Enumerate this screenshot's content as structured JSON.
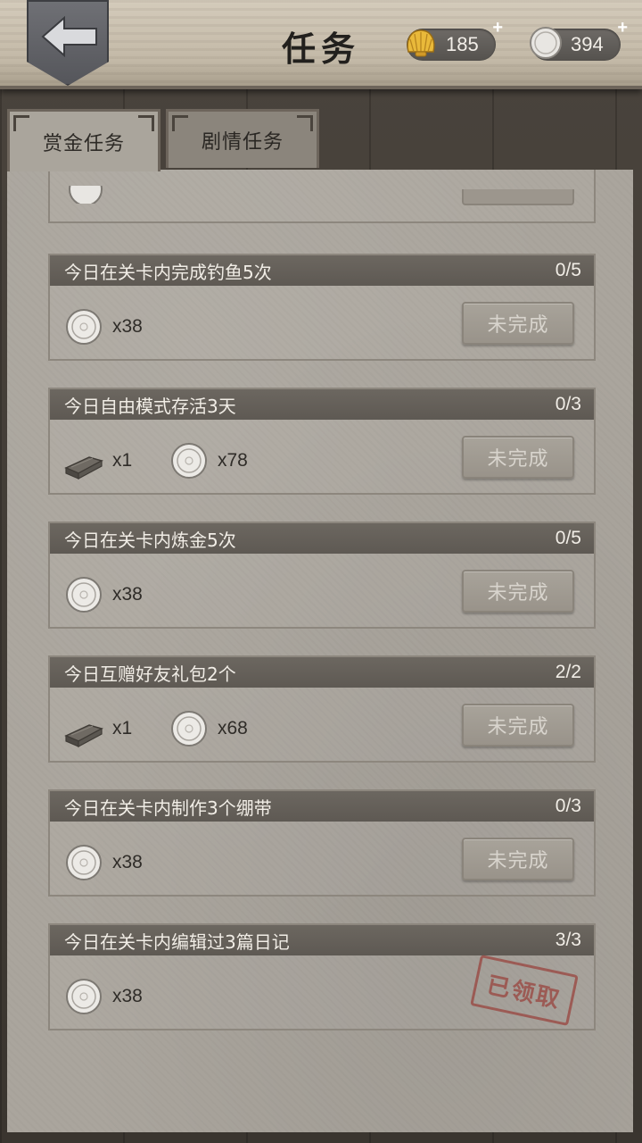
{
  "header": {
    "title": "任务",
    "shells": "185",
    "coins": "394",
    "plus": "+"
  },
  "tabs": [
    {
      "label": "赏金任务",
      "active": true
    },
    {
      "label": "剧情任务",
      "active": false
    }
  ],
  "icons": {
    "back": "arrow-left-icon",
    "shell": "shell-icon",
    "coin": "coin-icon",
    "wood": "wood-plank-icon"
  },
  "colors": {
    "paper": "#aaa59d",
    "task_header": "#6c6760",
    "stamp": "#9a4a44"
  },
  "tasks": [
    {
      "title": "今日在关卡内完成钓鱼5次",
      "progress": "0/5",
      "rewards": [
        {
          "icon": "coin-icon",
          "qty": "x38"
        }
      ],
      "button": "未完成"
    },
    {
      "title": "今日自由模式存活3天",
      "progress": "0/3",
      "rewards": [
        {
          "icon": "wood-plank-icon",
          "qty": "x1"
        },
        {
          "icon": "coin-icon",
          "qty": "x78"
        }
      ],
      "button": "未完成"
    },
    {
      "title": "今日在关卡内炼金5次",
      "progress": "0/5",
      "rewards": [
        {
          "icon": "coin-icon",
          "qty": "x38"
        }
      ],
      "button": "未完成"
    },
    {
      "title": "今日互赠好友礼包2个",
      "progress": "2/2",
      "rewards": [
        {
          "icon": "wood-plank-icon",
          "qty": "x1"
        },
        {
          "icon": "coin-icon",
          "qty": "x68"
        }
      ],
      "button": "未完成"
    },
    {
      "title": "今日在关卡内制作3个绷带",
      "progress": "0/3",
      "rewards": [
        {
          "icon": "coin-icon",
          "qty": "x38"
        }
      ],
      "button": "未完成"
    },
    {
      "title": "今日在关卡内编辑过3篇日记",
      "progress": "3/3",
      "rewards": [
        {
          "icon": "coin-icon",
          "qty": "x38"
        }
      ],
      "stamp": "已领取"
    }
  ]
}
